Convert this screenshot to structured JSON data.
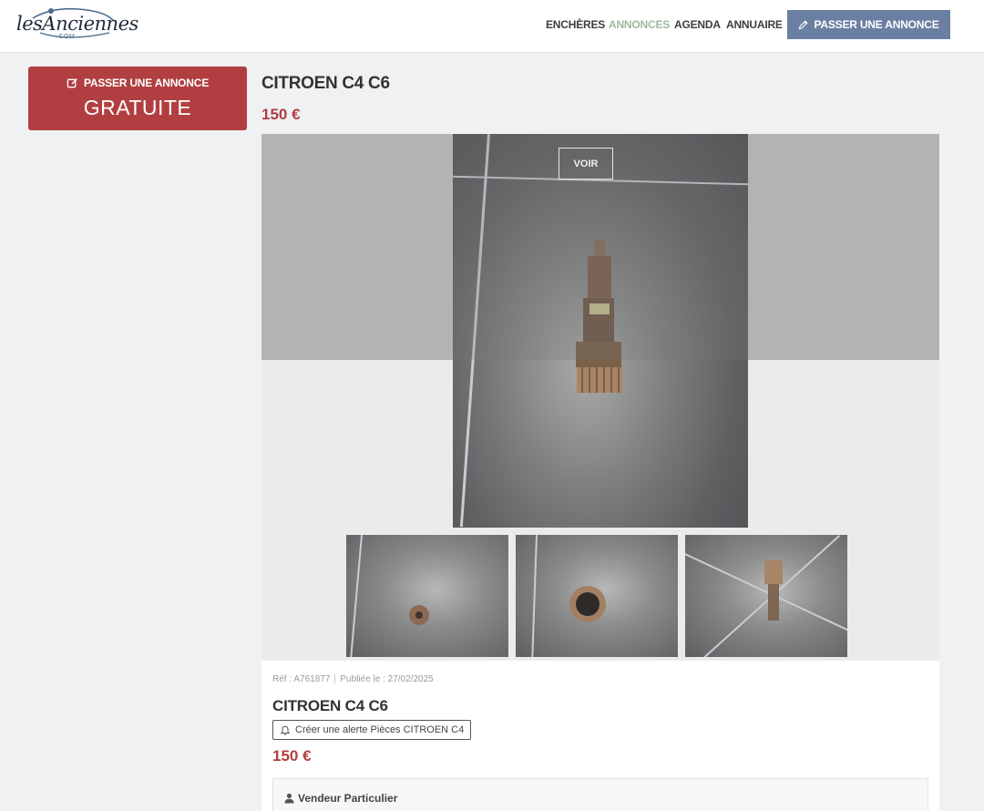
{
  "header": {
    "logo_text": "lesAnciennes",
    "logo_sub": ".COM",
    "nav": [
      "ENCHÈRES",
      "ANNONCES",
      "AGENDA",
      "ANNUAIRE"
    ],
    "active_nav": "ANNONCES",
    "cta_label": "PASSER UNE ANNONCE",
    "cta_icon": "pencil-icon",
    "cta_color": "#6b7fa2"
  },
  "promo": {
    "line1": "PASSER UNE ANNONCE",
    "line2": "GRATUITE",
    "icon": "edit-square-icon",
    "color": "#b13f41"
  },
  "listing": {
    "title": "CITROEN C4 C6",
    "price": "150 €",
    "price_color": "#b13f41",
    "view_button": "VOIR",
    "ref_label": "Réf : A761877",
    "published_label": "Publiée le : 27/02/2025",
    "alert_label": "Créer une alerte Pièces CITROEN C4",
    "seller_label": "Vendeur Particulier"
  }
}
